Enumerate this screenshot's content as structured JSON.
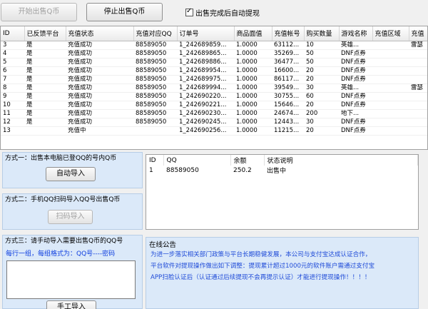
{
  "toolbar": {
    "start_label": "开始出售Q币",
    "stop_label": "停止出售Q币",
    "auto_withdraw_label": "出售完成后自动提现"
  },
  "orders": {
    "columns": [
      "ID",
      "已反馈平台",
      "充值状态",
      "充值对应QQ",
      "订单号",
      "商品面值",
      "充值帐号",
      "购买数量",
      "游戏名称",
      "充值区域",
      "充值"
    ],
    "rows": [
      [
        "3",
        "是",
        "充值成功",
        "88589050",
        "1_242689859...",
        "1.0000",
        "63112...",
        "10",
        "英雄...",
        "",
        "雷瑟"
      ],
      [
        "4",
        "是",
        "充值成功",
        "88589050",
        "1_242689865...",
        "1.0000",
        "35269...",
        "50",
        "DNF点券",
        "",
        ""
      ],
      [
        "5",
        "是",
        "充值成功",
        "88589050",
        "1_242689886...",
        "1.0000",
        "36477...",
        "50",
        "DNF点券",
        "",
        ""
      ],
      [
        "6",
        "是",
        "充值成功",
        "88589050",
        "1_242689954...",
        "1.0000",
        "16600...",
        "20",
        "DNF点券",
        "",
        ""
      ],
      [
        "7",
        "是",
        "充值成功",
        "88589050",
        "1_242689975...",
        "1.0000",
        "86117...",
        "20",
        "DNF点券",
        "",
        ""
      ],
      [
        "8",
        "是",
        "充值成功",
        "88589050",
        "1_242689994...",
        "1.0000",
        "39549...",
        "30",
        "英雄...",
        "",
        "雷瑟"
      ],
      [
        "9",
        "是",
        "充值成功",
        "88589050",
        "1_242690220...",
        "1.0000",
        "30755...",
        "60",
        "DNF点券",
        "",
        ""
      ],
      [
        "10",
        "是",
        "充值成功",
        "88589050",
        "1_242690221...",
        "1.0000",
        "15646...",
        "20",
        "DNF点券",
        "",
        ""
      ],
      [
        "11",
        "是",
        "充值成功",
        "88589050",
        "1_242690230...",
        "1.0000",
        "24674...",
        "200",
        "地下...",
        "",
        ""
      ],
      [
        "12",
        "是",
        "充值成功",
        "88589050",
        "1_242690245...",
        "1.0000",
        "12443...",
        "30",
        "DNF点券",
        "",
        ""
      ],
      [
        "13",
        "",
        "充值中",
        "",
        "1_242690256...",
        "1.0000",
        "11215...",
        "20",
        "DNF点券",
        "",
        ""
      ]
    ]
  },
  "method1": {
    "title": "方式一：出售本电脑已登QQ的号内Q币",
    "button": "自动导入"
  },
  "method2": {
    "title": "方式二：手机QQ扫码导入QQ号出售Q币",
    "button": "扫码导入"
  },
  "method3": {
    "title": "方式三：请手动导入需要出售Q币的QQ号",
    "hint": "每行一组，每组格式为：QQ号----密码",
    "button": "手工导入"
  },
  "qq_table": {
    "columns": [
      "ID",
      "QQ",
      "余额",
      "状态说明"
    ],
    "rows": [
      [
        "1",
        "88589050",
        "250.2",
        "出售中"
      ]
    ]
  },
  "notice": {
    "title": "在线公告",
    "lines": [
      "为进一步落实相关部门政策与平台长期稳健发展，本公司与支付宝达成认证合作，",
      "平台软件对提现操作做出如下调整：提现累计超过1000元的软件账户需通过支付宝",
      "APP扫脸认证后（认证通过后续提现不会再提示认证）才能进行提现操作！！！！"
    ]
  }
}
